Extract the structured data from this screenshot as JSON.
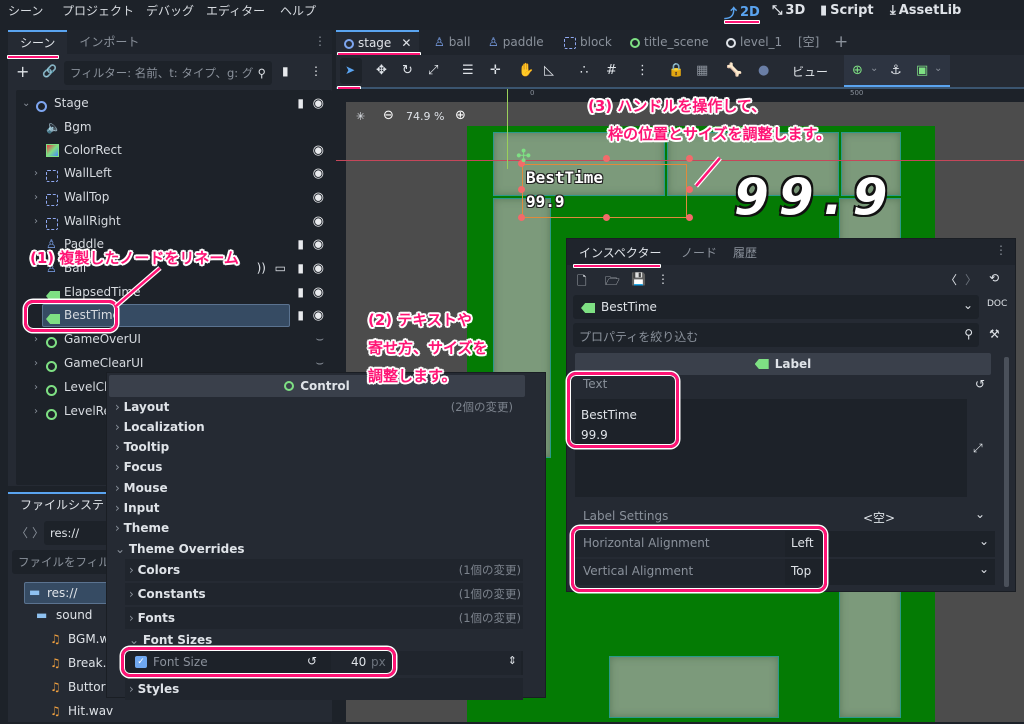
{
  "menubar": {
    "items": [
      "シーン",
      "プロジェクト",
      "デバッグ",
      "エディター",
      "ヘルプ"
    ],
    "modes": [
      {
        "label": "2D",
        "icon": "2d-icon",
        "active": true
      },
      {
        "label": "3D",
        "icon": "3d-icon",
        "active": false
      },
      {
        "label": "Script",
        "icon": "script-icon",
        "active": false
      },
      {
        "label": "AssetLib",
        "icon": "assetlib-icon",
        "active": false
      }
    ]
  },
  "scene_dock": {
    "tabs": [
      "シーン",
      "インポート"
    ],
    "filter_placeholder": "フィルター: 名前、t: タイプ、g: グ",
    "nodes": [
      {
        "name": "Stage",
        "icon": "node-icon"
      },
      {
        "name": "Bgm",
        "icon": "audio-stream-player-icon"
      },
      {
        "name": "ColorRect",
        "icon": "color-rect-icon"
      },
      {
        "name": "WallLeft",
        "icon": "static-body-icon"
      },
      {
        "name": "WallTop",
        "icon": "static-body-icon"
      },
      {
        "name": "WallRight",
        "icon": "static-body-icon"
      },
      {
        "name": "Paddle",
        "icon": "character-body-icon"
      },
      {
        "name": "Ball",
        "icon": "character-body-icon"
      },
      {
        "name": "ElapsedTime",
        "icon": "label-icon"
      },
      {
        "name": "BestTime",
        "icon": "label-icon",
        "selected": true
      },
      {
        "name": "GameOverUI",
        "icon": "control-icon"
      },
      {
        "name": "GameClearUI",
        "icon": "control-icon"
      },
      {
        "name": "LevelCle",
        "icon": "control-icon"
      },
      {
        "name": "LevelRea",
        "icon": "control-icon"
      }
    ]
  },
  "file_dock": {
    "tab": "ファイルシステ",
    "path": "res://",
    "filter_placeholder": "ファイルをフィル",
    "items": [
      {
        "name": "res://",
        "type": "folder"
      },
      {
        "name": "sound",
        "type": "folder"
      },
      {
        "name": "BGM.w",
        "type": "audio"
      },
      {
        "name": "Break.",
        "type": "audio"
      },
      {
        "name": "Buttor",
        "type": "audio"
      },
      {
        "name": "Hit.wav",
        "type": "audio"
      }
    ]
  },
  "scene_tabs": [
    {
      "label": "stage",
      "active": true
    },
    {
      "label": "ball"
    },
    {
      "label": "paddle"
    },
    {
      "label": "block"
    },
    {
      "label": "title_scene"
    },
    {
      "label": "level_1"
    },
    {
      "label": "[空]"
    }
  ],
  "toolbar": {
    "view_label": "ビュー"
  },
  "viewport": {
    "zoom": "74.9 %",
    "ruler_marks": [
      "0",
      "500"
    ],
    "label_text_line1": "BestTime",
    "label_text_line2": "99.9",
    "big_time": "99.9"
  },
  "control_panel": {
    "header": "Control",
    "sections": [
      {
        "label": "Layout",
        "changes": "(2個の変更)"
      },
      {
        "label": "Localization"
      },
      {
        "label": "Tooltip"
      },
      {
        "label": "Focus"
      },
      {
        "label": "Mouse"
      },
      {
        "label": "Input"
      },
      {
        "label": "Theme"
      },
      {
        "label": "Theme Overrides",
        "expanded": true
      }
    ],
    "overrides": [
      {
        "label": "Colors",
        "changes": "(1個の変更)"
      },
      {
        "label": "Constants",
        "changes": "(1個の変更)"
      },
      {
        "label": "Fonts",
        "changes": "(1個の変更)"
      },
      {
        "label": "Font Sizes",
        "expanded": true
      },
      {
        "label": "Styles"
      }
    ],
    "font_size": {
      "label": "Font Size",
      "value": "40",
      "unit": "px",
      "checked": true
    }
  },
  "inspector": {
    "tabs": [
      "インスペクター",
      "ノード",
      "履歴"
    ],
    "object": "BestTime",
    "filter_placeholder": "プロパティを絞り込む",
    "class_header": "Label",
    "text_label": "Text",
    "text_value_line1": "BestTime",
    "text_value_line2": "99.9",
    "label_settings": {
      "label": "Label Settings",
      "value": "<空>"
    },
    "horizontal_alignment": {
      "label": "Horizontal Alignment",
      "value": "Left"
    },
    "vertical_alignment": {
      "label": "Vertical Alignment",
      "value": "Top"
    }
  },
  "annotations": {
    "a1": "(1) 複製したノードをリネーム",
    "a2_line1": "(2) テキストや",
    "a2_line2": "寄せ方、サイズを",
    "a2_line3": "調整します。",
    "a3_line1": "(3) ハンドルを操作して、",
    "a3_line2": "枠の位置とサイズを調整します。"
  },
  "colors": {
    "accent": "#5aa4f0",
    "annotation": "#ff1475",
    "label_green": "#7ee083",
    "game_bg": "#047b04"
  }
}
